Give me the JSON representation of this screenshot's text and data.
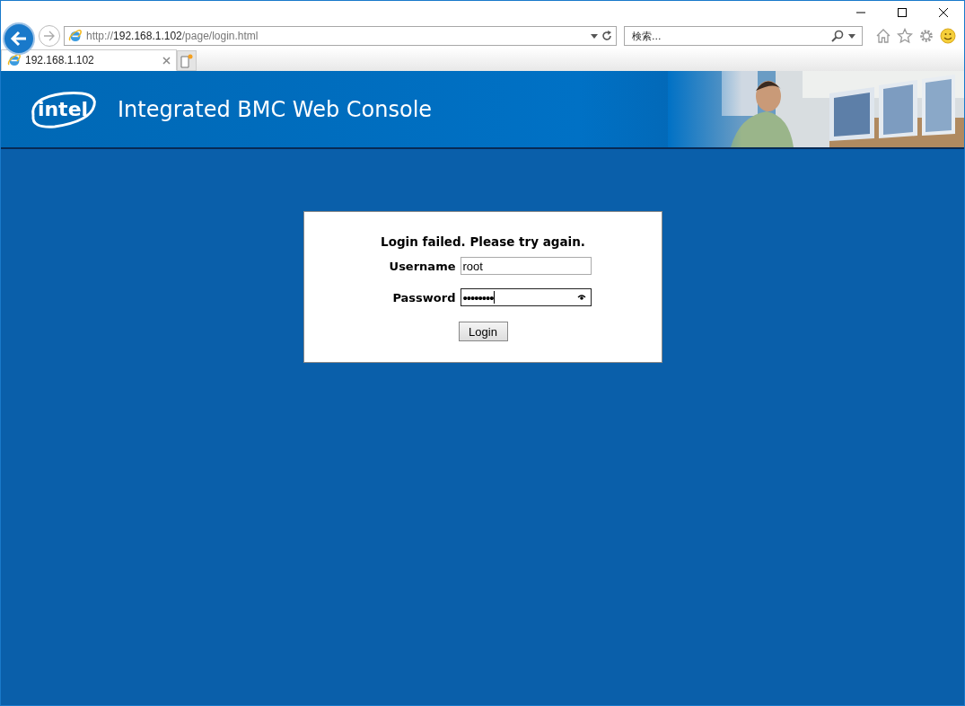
{
  "browser": {
    "address": {
      "scheme": "http://",
      "host": "192.168.1.102",
      "path": "/page/login.html"
    },
    "search": {
      "placeholder": "検索..."
    },
    "tabs": [
      {
        "label": "192.168.1.102",
        "selected": true
      }
    ]
  },
  "header": {
    "logo": "intel",
    "title": "Integrated BMC Web Console"
  },
  "login": {
    "message": "Login failed. Please try again.",
    "fields": [
      {
        "label": "Username",
        "value": "root",
        "kind": "text",
        "focused": false
      },
      {
        "label": "Password",
        "value": "••••••••",
        "kind": "password",
        "focused": true
      }
    ],
    "button": "Login"
  }
}
